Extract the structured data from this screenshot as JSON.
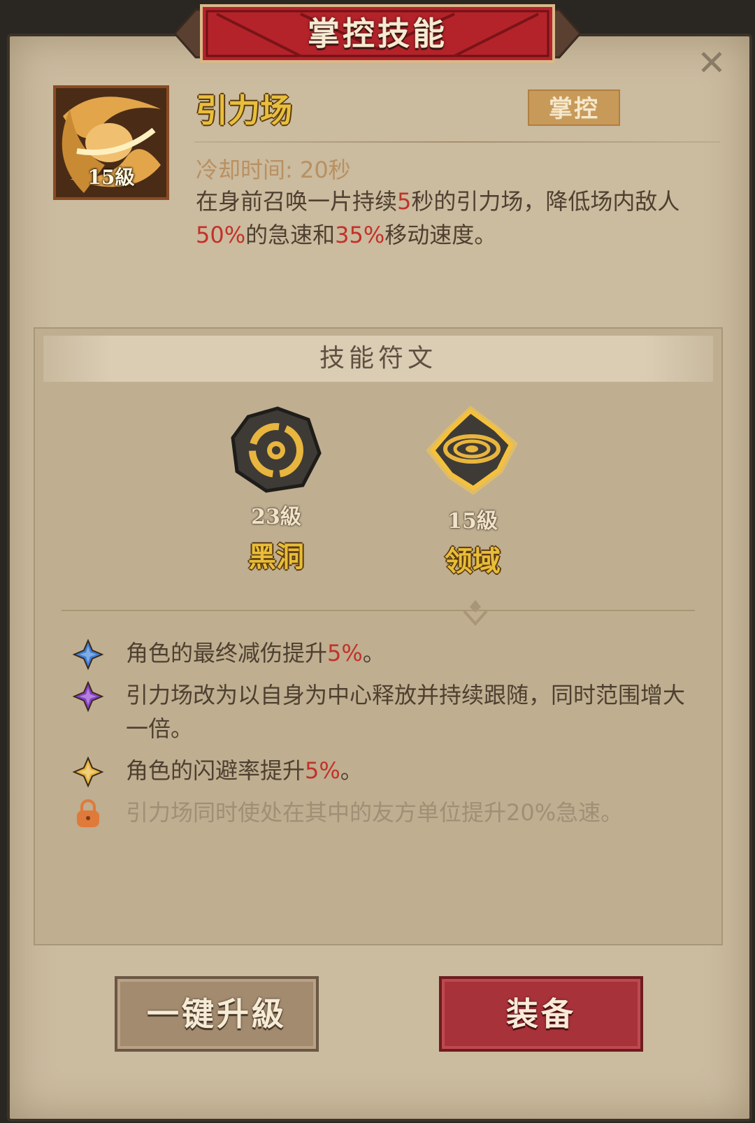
{
  "header": {
    "title": "掌控技能",
    "close_label": "✕"
  },
  "skill": {
    "name": "引力场",
    "level_label": "15級",
    "type_badge": "掌控",
    "cooldown": "冷却时间: 20秒",
    "description": [
      {
        "t": "在身前召唤一片持续",
        "h": false
      },
      {
        "t": "5",
        "h": true
      },
      {
        "t": "秒的引力场，降低场内敌人",
        "h": false
      },
      {
        "t": "50%",
        "h": true
      },
      {
        "t": "的急速和",
        "h": false
      },
      {
        "t": "35%",
        "h": true
      },
      {
        "t": "移动速度。",
        "h": false
      }
    ]
  },
  "runes": {
    "section_title": "技能符文",
    "items": [
      {
        "name": "黑洞",
        "level": "23級",
        "selected": false
      },
      {
        "name": "领域",
        "level": "15級",
        "selected": true
      }
    ]
  },
  "effects": [
    {
      "icon": "blue-diamond-icon",
      "color": "#3f7fd6",
      "locked": false,
      "segments": [
        {
          "t": "角色的最终减伤提升",
          "h": false
        },
        {
          "t": "5%",
          "h": true
        },
        {
          "t": "。",
          "h": false
        }
      ]
    },
    {
      "icon": "purple-diamond-icon",
      "color": "#8a3fc8",
      "locked": false,
      "segments": [
        {
          "t": "引力场改为以自身为中心释放并持续跟随，同时范围增大一倍。",
          "h": false
        }
      ]
    },
    {
      "icon": "gold-diamond-icon",
      "color": "#e6b43a",
      "locked": false,
      "segments": [
        {
          "t": "角色的闪避率提升",
          "h": false
        },
        {
          "t": "5%",
          "h": true
        },
        {
          "t": "。",
          "h": false
        }
      ]
    },
    {
      "icon": "lock-icon",
      "color": "#e07a3a",
      "locked": true,
      "segments": [
        {
          "t": "引力场同时使处在其中的友方单位提升20%急速。",
          "h": false
        }
      ]
    }
  ],
  "buttons": {
    "upgrade_label": "一键升級",
    "equip_label": "装备"
  },
  "colors": {
    "highlight": "#c23228",
    "gold_text": "#e8bf3c",
    "equip_red": "#a8323a"
  }
}
